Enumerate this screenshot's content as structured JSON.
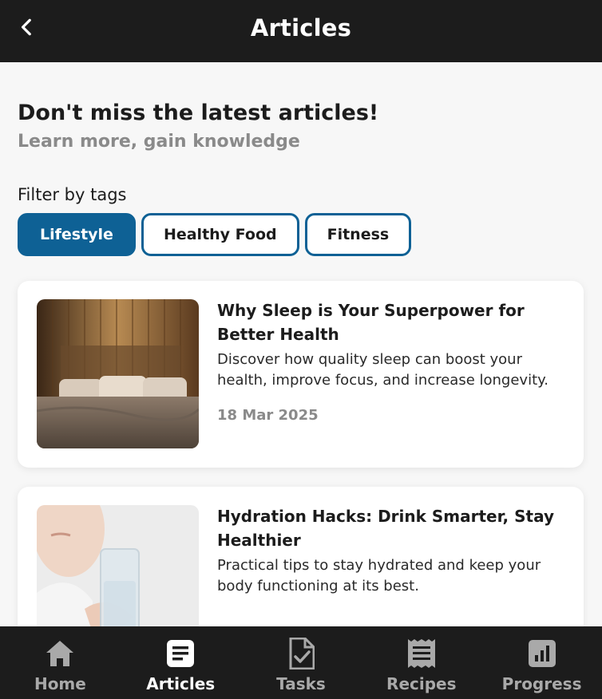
{
  "header": {
    "title": "Articles",
    "back_icon": "chevron-left-icon"
  },
  "intro": {
    "title": "Don't miss the latest articles!",
    "subtitle": "Learn more, gain knowledge"
  },
  "filter": {
    "label": "Filter by tags",
    "tags": [
      {
        "label": "Lifestyle",
        "active": true
      },
      {
        "label": "Healthy Food",
        "active": false
      },
      {
        "label": "Fitness",
        "active": false
      }
    ]
  },
  "articles": [
    {
      "title": "Why Sleep is Your Superpower for Better Health",
      "description": "Discover how quality sleep can boost your health, improve focus, and increase longevity.",
      "date": "18 Mar 2025",
      "image_icon": "bedroom-photo"
    },
    {
      "title": "Hydration Hacks: Drink Smarter, Stay Healthier",
      "description": "Practical tips to stay hydrated and keep your body functioning at its best.",
      "image_icon": "drinking-water-photo"
    }
  ],
  "nav": {
    "items": [
      {
        "label": "Home",
        "icon": "home-icon",
        "active": false
      },
      {
        "label": "Articles",
        "icon": "article-icon",
        "active": true
      },
      {
        "label": "Tasks",
        "icon": "task-icon",
        "active": false
      },
      {
        "label": "Recipes",
        "icon": "receipt-icon",
        "active": false
      },
      {
        "label": "Progress",
        "icon": "bar-chart-icon",
        "active": false
      }
    ]
  },
  "colors": {
    "header_bg": "#1c1c1c",
    "accent": "#0e6195",
    "page_bg": "#f7f7f7",
    "muted_text": "#8a8a8a"
  }
}
